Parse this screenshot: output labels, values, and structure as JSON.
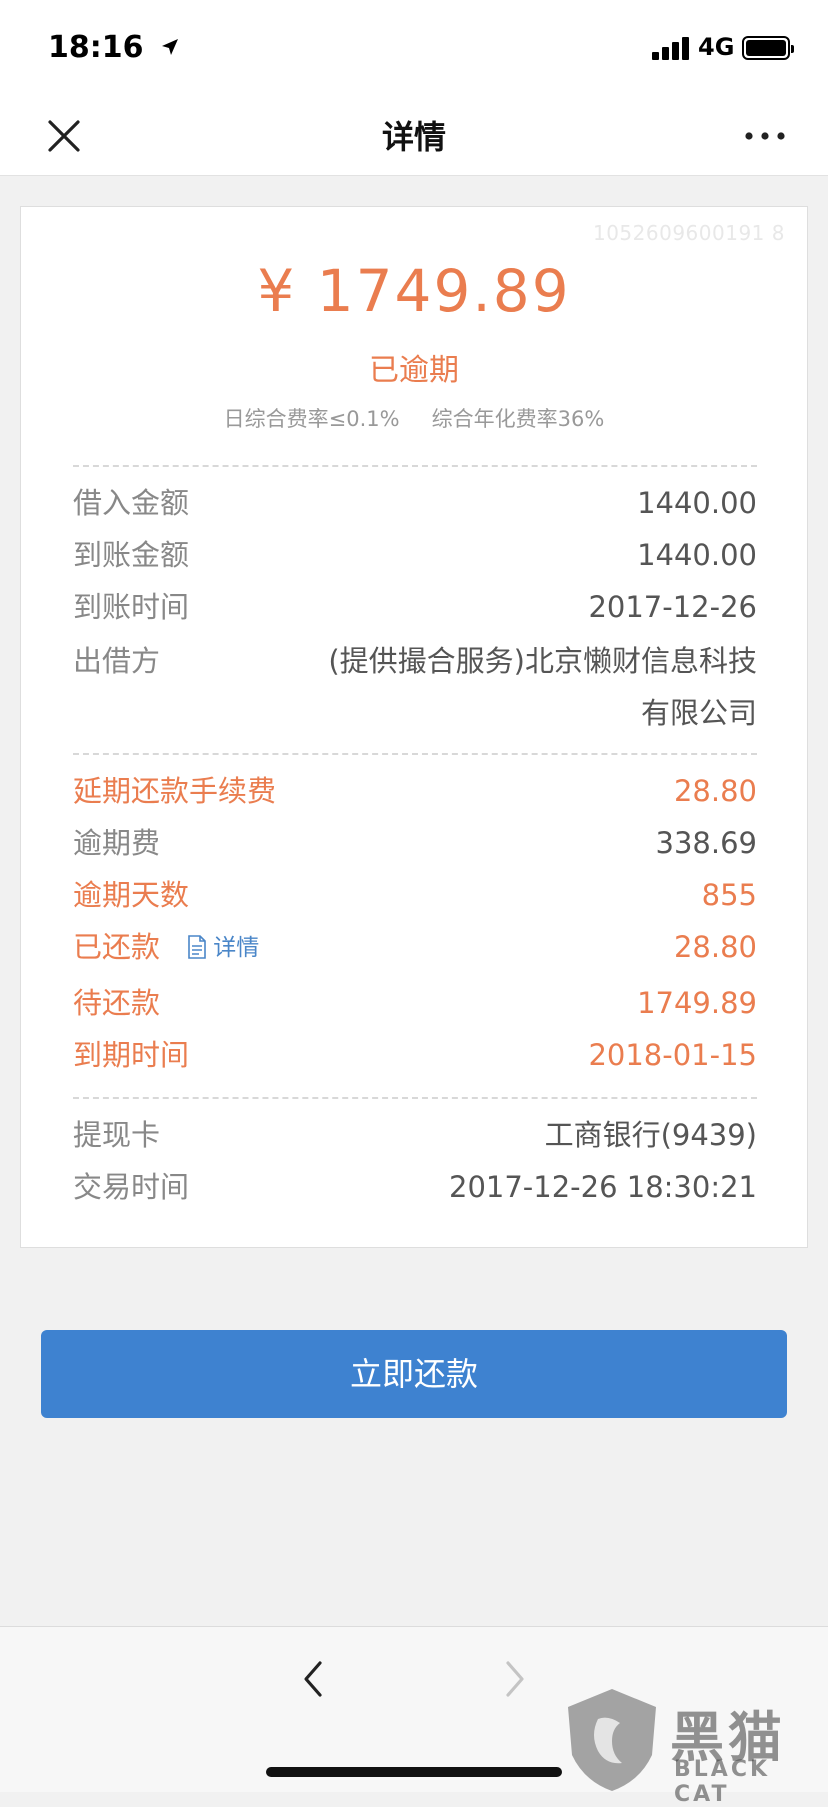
{
  "status_bar": {
    "time": "18:16",
    "network": "4G"
  },
  "nav": {
    "title": "详情"
  },
  "summary": {
    "order_no": "1052609600191 8",
    "amount": "¥ 1749.89",
    "status": "已逾期",
    "daily_rate": "日综合费率≤0.1%",
    "annual_rate": "综合年化费率36%"
  },
  "loan": {
    "borrow_amount_label": "借入金额",
    "borrow_amount": "1440.00",
    "received_amount_label": "到账金额",
    "received_amount": "1440.00",
    "received_time_label": "到账时间",
    "received_time": "2017-12-26",
    "lender_label": "出借方",
    "lender": "(提供撮合服务)北京懒财信息科技有限公司"
  },
  "overdue": {
    "extension_fee_label": "延期还款手续费",
    "extension_fee": "28.80",
    "overdue_fee_label": "逾期费",
    "overdue_fee": "338.69",
    "overdue_days_label": "逾期天数",
    "overdue_days": "855",
    "repaid_label": "已还款",
    "repaid_detail": "详情",
    "repaid": "28.80",
    "pending_label": "待还款",
    "pending": "1749.89",
    "due_time_label": "到期时间",
    "due_time": "2018-01-15"
  },
  "card_info": {
    "card_label": "提现卡",
    "card": "工商银行(9439)",
    "trade_time_label": "交易时间",
    "trade_time": "2017-12-26 18:30:21"
  },
  "actions": {
    "repay_now": "立即还款"
  },
  "watermark": {
    "cn": "黑猫",
    "en": "BLACK CAT"
  },
  "colors": {
    "accent_orange": "#ea7d4f",
    "button_blue": "#3e82d0",
    "link_blue": "#4a86c8"
  }
}
